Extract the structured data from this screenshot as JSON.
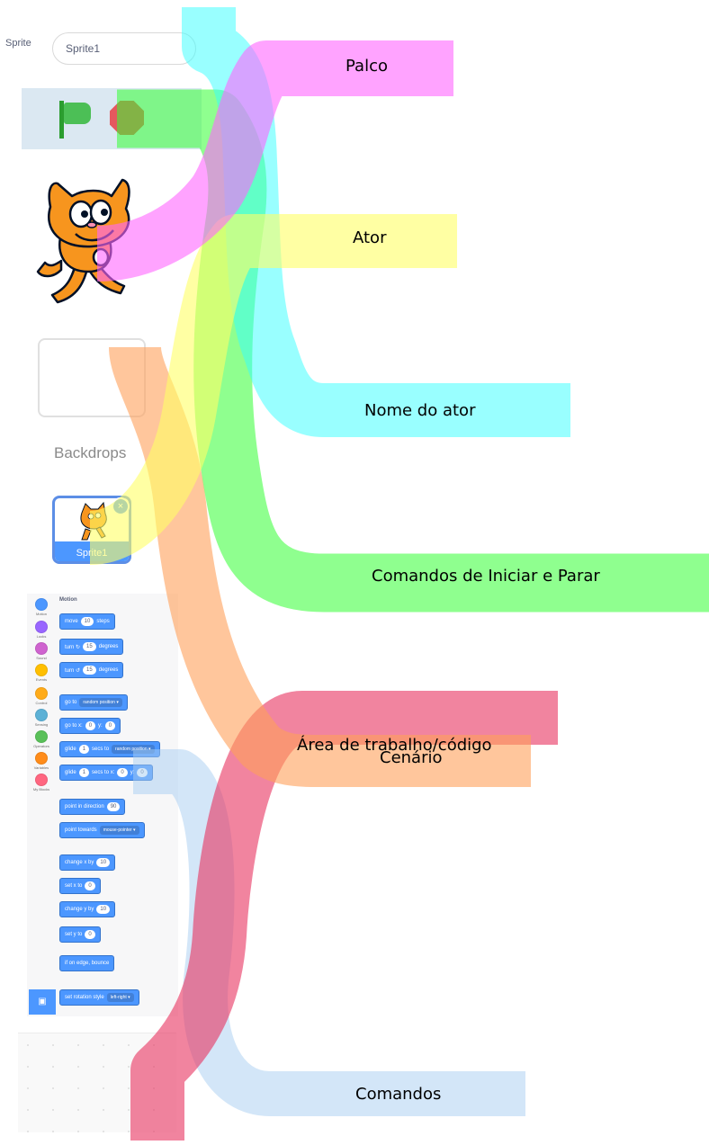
{
  "sprite_info": {
    "sprite_label": "Sprite",
    "sprite_name": "Sprite1"
  },
  "stage_controls": {
    "flag_icon": "green-flag-icon",
    "stop_icon": "stop-icon"
  },
  "stage_panel": {
    "backdrops_label": "Backdrops"
  },
  "sprite_list": {
    "tile_label": "Sprite1"
  },
  "block_palette": {
    "heading": "Motion",
    "categories": [
      {
        "label": "Motion",
        "color": "#4c97ff"
      },
      {
        "label": "Looks",
        "color": "#9966ff"
      },
      {
        "label": "Sound",
        "color": "#cf63cf"
      },
      {
        "label": "Events",
        "color": "#ffbf00"
      },
      {
        "label": "Control",
        "color": "#ffab19"
      },
      {
        "label": "Sensing",
        "color": "#5cb1d6"
      },
      {
        "label": "Operators",
        "color": "#59c059"
      },
      {
        "label": "Variables",
        "color": "#ff8c1a"
      },
      {
        "label": "My Blocks",
        "color": "#ff6680"
      }
    ],
    "blocks": [
      {
        "parts": [
          {
            "t": "text",
            "v": "move"
          },
          {
            "t": "pill",
            "v": "10"
          },
          {
            "t": "text",
            "v": "steps"
          }
        ]
      },
      {
        "parts": [
          {
            "t": "text",
            "v": "turn ↻"
          },
          {
            "t": "pill",
            "v": "15"
          },
          {
            "t": "text",
            "v": "degrees"
          }
        ]
      },
      {
        "parts": [
          {
            "t": "text",
            "v": "turn ↺"
          },
          {
            "t": "pill",
            "v": "15"
          },
          {
            "t": "text",
            "v": "degrees"
          }
        ]
      },
      {
        "parts": [
          {
            "t": "text",
            "v": "go to"
          },
          {
            "t": "drop",
            "v": "random position ▾"
          }
        ]
      },
      {
        "parts": [
          {
            "t": "text",
            "v": "go to x:"
          },
          {
            "t": "pill",
            "v": "0"
          },
          {
            "t": "text",
            "v": "y:"
          },
          {
            "t": "pill",
            "v": "0"
          }
        ]
      },
      {
        "parts": [
          {
            "t": "text",
            "v": "glide"
          },
          {
            "t": "pill",
            "v": "1"
          },
          {
            "t": "text",
            "v": "secs to"
          },
          {
            "t": "drop",
            "v": "random position ▾"
          }
        ]
      },
      {
        "parts": [
          {
            "t": "text",
            "v": "glide"
          },
          {
            "t": "pill",
            "v": "1"
          },
          {
            "t": "text",
            "v": "secs to x:"
          },
          {
            "t": "pill",
            "v": "0"
          },
          {
            "t": "text",
            "v": "y:"
          },
          {
            "t": "pill",
            "v": "0"
          }
        ]
      },
      {
        "parts": [
          {
            "t": "text",
            "v": "point in direction"
          },
          {
            "t": "pill",
            "v": "90"
          }
        ]
      },
      {
        "parts": [
          {
            "t": "text",
            "v": "point towards"
          },
          {
            "t": "drop",
            "v": "mouse-pointer ▾"
          }
        ]
      },
      {
        "parts": [
          {
            "t": "text",
            "v": "change x by"
          },
          {
            "t": "pill",
            "v": "10"
          }
        ]
      },
      {
        "parts": [
          {
            "t": "text",
            "v": "set x to"
          },
          {
            "t": "pill",
            "v": "0"
          }
        ]
      },
      {
        "parts": [
          {
            "t": "text",
            "v": "change y by"
          },
          {
            "t": "pill",
            "v": "10"
          }
        ]
      },
      {
        "parts": [
          {
            "t": "text",
            "v": "set y to"
          },
          {
            "t": "pill",
            "v": "0"
          }
        ]
      },
      {
        "parts": [
          {
            "t": "text",
            "v": "if on edge, bounce"
          }
        ]
      },
      {
        "parts": [
          {
            "t": "text",
            "v": "set rotation style"
          },
          {
            "t": "drop",
            "v": "left-right ▾"
          }
        ]
      }
    ],
    "extension_icon": "add-extension-icon"
  },
  "callouts": [
    {
      "key": "palco",
      "text": "Palco",
      "color": "#ff66ff"
    },
    {
      "key": "ator",
      "text": "Ator",
      "color": "#ffff66"
    },
    {
      "key": "nome_do_ator",
      "text": "Nome do ator",
      "color": "#33ffff"
    },
    {
      "key": "comandos_iniciar_parar",
      "text": "Comandos de Iniciar e Parar",
      "color": "#33ff33"
    },
    {
      "key": "cenario",
      "text": "Cenário",
      "color": "#ffa05a"
    },
    {
      "key": "area_trabalho",
      "text": "Área de trabalho/código",
      "color": "#e8325f"
    },
    {
      "key": "comandos",
      "text": "Comandos",
      "color": "#b4d4f5"
    }
  ]
}
